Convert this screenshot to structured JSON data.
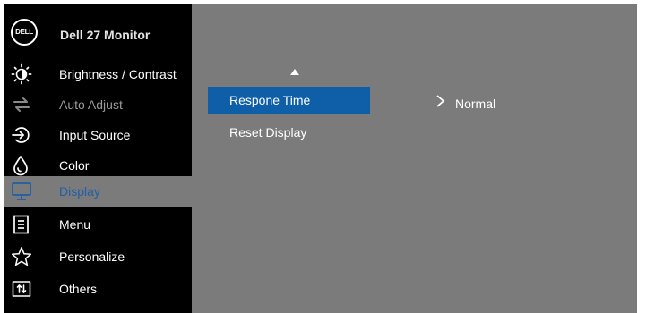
{
  "window": {
    "logo_text": "DELL",
    "title": "Dell 27 Monitor"
  },
  "colors": {
    "osd_background": "#7b7b7b",
    "sidebar_background": "#000000",
    "selection_blue": "#0e5ea8",
    "selected_label_blue": "#1e5fa8",
    "disabled_text": "#9a9a9a"
  },
  "sidebar": {
    "items": [
      {
        "label": "Brightness / Contrast",
        "icon": "brightness-icon",
        "state": "normal"
      },
      {
        "label": "Auto Adjust",
        "icon": "auto-adjust-icon",
        "state": "disabled"
      },
      {
        "label": "Input Source",
        "icon": "input-source-icon",
        "state": "normal"
      },
      {
        "label": "Color",
        "icon": "color-icon",
        "state": "normal"
      },
      {
        "label": "Display",
        "icon": "display-icon",
        "state": "selected"
      },
      {
        "label": "Menu",
        "icon": "menu-icon",
        "state": "normal"
      },
      {
        "label": "Personalize",
        "icon": "star-icon",
        "state": "normal"
      },
      {
        "label": "Others",
        "icon": "others-icon",
        "state": "normal"
      }
    ]
  },
  "submenu": {
    "scroll_up_icon": "up-triangle-icon",
    "items": [
      {
        "label": "Respone Time",
        "state": "highlighted"
      },
      {
        "label": "Reset Display",
        "state": "normal"
      }
    ]
  },
  "value_panel": {
    "arrow_icon": "chevron-right-icon",
    "value": "Normal"
  }
}
